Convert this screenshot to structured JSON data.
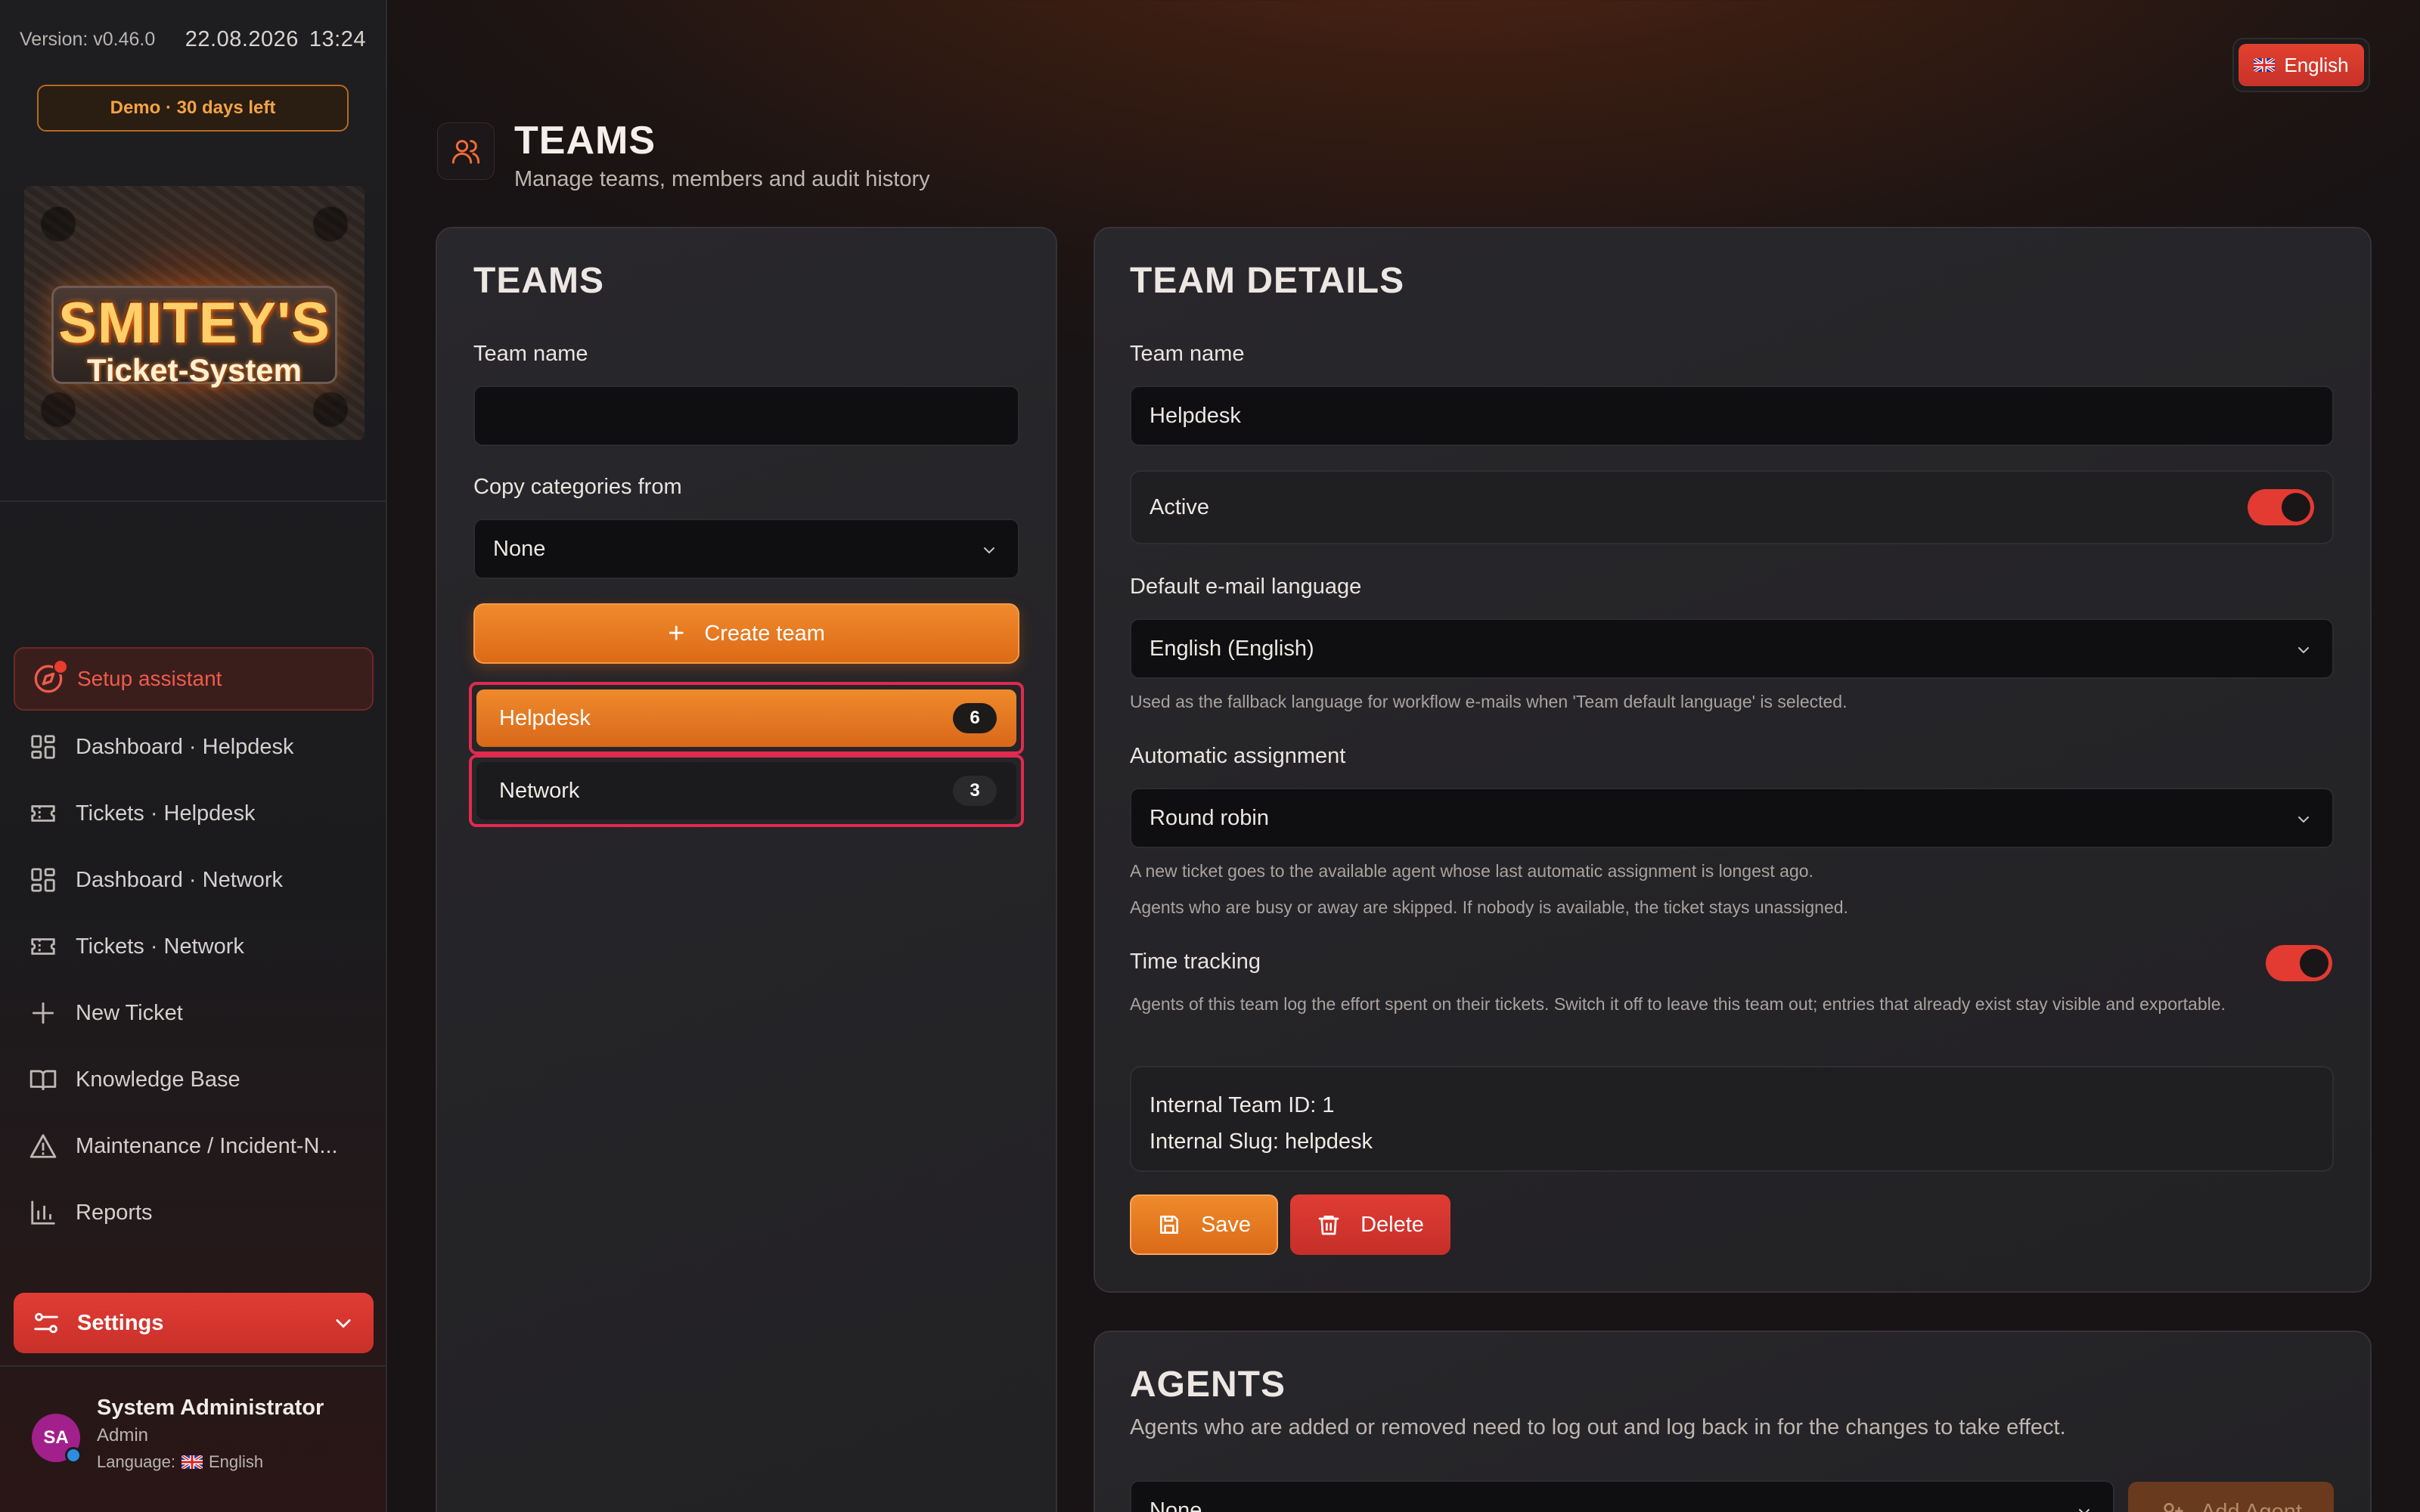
{
  "sidebar": {
    "version": "Version: v0.46.0",
    "date": "22.08.2026",
    "time": "13:24",
    "demo_badge": "Demo · 30 days left",
    "logo": {
      "title": "SMITEY'S",
      "subtitle": "Ticket-System"
    },
    "setup_assistant": "Setup assistant",
    "nav": [
      {
        "label": "Dashboard · Helpdesk",
        "icon": "dashboard-icon"
      },
      {
        "label": "Tickets · Helpdesk",
        "icon": "ticket-icon"
      },
      {
        "label": "Dashboard · Network",
        "icon": "dashboard-icon"
      },
      {
        "label": "Tickets · Network",
        "icon": "ticket-icon"
      },
      {
        "label": "New Ticket",
        "icon": "plus-icon"
      },
      {
        "label": "Knowledge Base",
        "icon": "book-icon"
      },
      {
        "label": "Maintenance / Incident-N...",
        "icon": "warning-icon"
      },
      {
        "label": "Reports",
        "icon": "chart-icon"
      }
    ],
    "settings": "Settings",
    "user": {
      "initials": "SA",
      "name": "System Administrator",
      "role": "Admin",
      "language_label": "Language:",
      "language": "English"
    }
  },
  "header": {
    "language_button": "English",
    "title": "TEAMS",
    "subtitle": "Manage teams, members and audit history"
  },
  "teams_panel": {
    "title": "TEAMS",
    "team_name_label": "Team name",
    "team_name_value": "",
    "copy_label": "Copy categories from",
    "copy_value": "None",
    "create_button": "Create team",
    "teams": [
      {
        "name": "Helpdesk",
        "count": "6",
        "active": true
      },
      {
        "name": "Network",
        "count": "3",
        "active": false
      }
    ]
  },
  "details": {
    "title": "TEAM DETAILS",
    "team_name_label": "Team name",
    "team_name_value": "Helpdesk",
    "active_label": "Active",
    "active": true,
    "email_lang_label": "Default e-mail language",
    "email_lang_value": "English (English)",
    "email_lang_hint": "Used as the fallback language for workflow e-mails when 'Team default language' is selected.",
    "assignment_label": "Automatic assignment",
    "assignment_value": "Round robin",
    "assignment_hint_1": "A new ticket goes to the available agent whose last automatic assignment is longest ago.",
    "assignment_hint_2": "Agents who are busy or away are skipped. If nobody is available, the ticket stays unassigned.",
    "time_tracking_label": "Time tracking",
    "time_tracking": true,
    "time_tracking_hint": "Agents of this team log the effort spent on their tickets. Switch it off to leave this team out; entries that already exist stay visible and exportable.",
    "internal_id": "Internal Team ID: 1",
    "internal_slug": "Internal Slug: helpdesk",
    "save_button": "Save",
    "delete_button": "Delete"
  },
  "agents": {
    "title": "AGENTS",
    "subtitle": "Agents who are added or removed need to log out and log back in for the changes to take effect.",
    "select_value": "None",
    "add_button": "Add Agent"
  },
  "colors": {
    "accent_orange": "#e8781f",
    "accent_red": "#e03c34",
    "highlight_pink": "#e02a4e",
    "background": "#1f1513"
  }
}
